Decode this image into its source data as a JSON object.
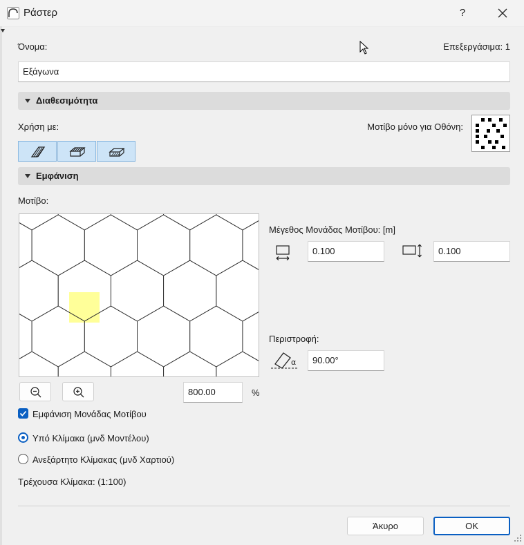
{
  "window": {
    "title": "Ράστερ",
    "help_label": "?"
  },
  "name_row": {
    "label": "Όνομα:",
    "edit_label": "Επεξεργάσιμα: 1",
    "value": "Εξάγωνα"
  },
  "availability": {
    "header": "Διαθεσιμότητα",
    "use_with_label": "Χρήση με:",
    "screen_only_label": "Μοτίβο μόνο για Οθόνη:",
    "use_buttons": [
      "cut-fill-icon",
      "cover-fill-icon",
      "draft-fill-icon"
    ]
  },
  "appearance": {
    "header": "Εμφάνιση",
    "pattern_label": "Μοτίβο:",
    "unit_size_label": "Μέγεθος Μονάδας Μοτίβου: [m]",
    "width_value": "0.100",
    "height_value": "0.100",
    "rotation_label": "Περιστροφή:",
    "rotation_value": "90.00°",
    "zoom_value": "800.00",
    "zoom_unit": "%",
    "show_unit_label": "Εμφάνιση Μονάδας Μοτίβου",
    "show_unit_checked": true,
    "scale_options": [
      {
        "label": "Υπό Κλίμακα (μνδ Μοντέλου)",
        "selected": true
      },
      {
        "label": "Ανεξάρτητο Κλίμακας (μνδ Χαρτιού)",
        "selected": false
      }
    ],
    "current_scale": "Τρέχουσα Κλίμακα: (1:100)"
  },
  "footer": {
    "cancel_label": "Άκυρο",
    "ok_label": "OK"
  },
  "colors": {
    "accent": "#0a5fc2",
    "unit_highlight": "#ffff99"
  }
}
